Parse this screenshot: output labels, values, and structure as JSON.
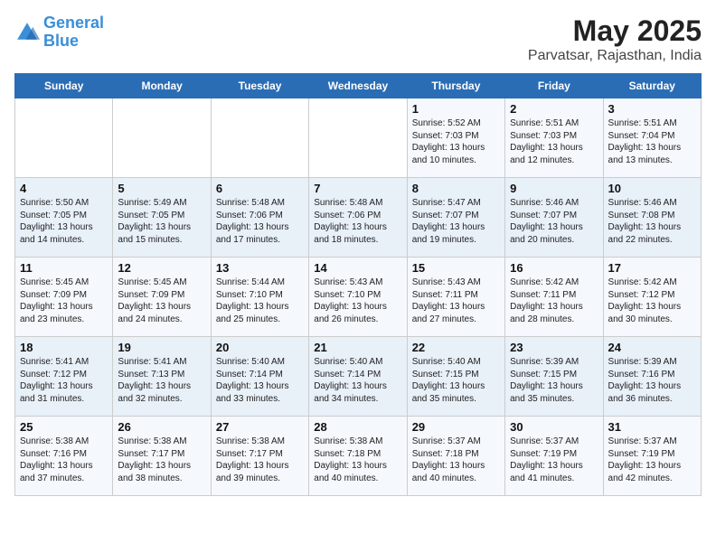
{
  "logo": {
    "line1": "General",
    "line2": "Blue"
  },
  "title": "May 2025",
  "subtitle": "Parvatsar, Rajasthan, India",
  "days_of_week": [
    "Sunday",
    "Monday",
    "Tuesday",
    "Wednesday",
    "Thursday",
    "Friday",
    "Saturday"
  ],
  "weeks": [
    [
      {
        "num": "",
        "lines": []
      },
      {
        "num": "",
        "lines": []
      },
      {
        "num": "",
        "lines": []
      },
      {
        "num": "",
        "lines": []
      },
      {
        "num": "1",
        "lines": [
          "Sunrise: 5:52 AM",
          "Sunset: 7:03 PM",
          "Daylight: 13 hours",
          "and 10 minutes."
        ]
      },
      {
        "num": "2",
        "lines": [
          "Sunrise: 5:51 AM",
          "Sunset: 7:03 PM",
          "Daylight: 13 hours",
          "and 12 minutes."
        ]
      },
      {
        "num": "3",
        "lines": [
          "Sunrise: 5:51 AM",
          "Sunset: 7:04 PM",
          "Daylight: 13 hours",
          "and 13 minutes."
        ]
      }
    ],
    [
      {
        "num": "4",
        "lines": [
          "Sunrise: 5:50 AM",
          "Sunset: 7:05 PM",
          "Daylight: 13 hours",
          "and 14 minutes."
        ]
      },
      {
        "num": "5",
        "lines": [
          "Sunrise: 5:49 AM",
          "Sunset: 7:05 PM",
          "Daylight: 13 hours",
          "and 15 minutes."
        ]
      },
      {
        "num": "6",
        "lines": [
          "Sunrise: 5:48 AM",
          "Sunset: 7:06 PM",
          "Daylight: 13 hours",
          "and 17 minutes."
        ]
      },
      {
        "num": "7",
        "lines": [
          "Sunrise: 5:48 AM",
          "Sunset: 7:06 PM",
          "Daylight: 13 hours",
          "and 18 minutes."
        ]
      },
      {
        "num": "8",
        "lines": [
          "Sunrise: 5:47 AM",
          "Sunset: 7:07 PM",
          "Daylight: 13 hours",
          "and 19 minutes."
        ]
      },
      {
        "num": "9",
        "lines": [
          "Sunrise: 5:46 AM",
          "Sunset: 7:07 PM",
          "Daylight: 13 hours",
          "and 20 minutes."
        ]
      },
      {
        "num": "10",
        "lines": [
          "Sunrise: 5:46 AM",
          "Sunset: 7:08 PM",
          "Daylight: 13 hours",
          "and 22 minutes."
        ]
      }
    ],
    [
      {
        "num": "11",
        "lines": [
          "Sunrise: 5:45 AM",
          "Sunset: 7:09 PM",
          "Daylight: 13 hours",
          "and 23 minutes."
        ]
      },
      {
        "num": "12",
        "lines": [
          "Sunrise: 5:45 AM",
          "Sunset: 7:09 PM",
          "Daylight: 13 hours",
          "and 24 minutes."
        ]
      },
      {
        "num": "13",
        "lines": [
          "Sunrise: 5:44 AM",
          "Sunset: 7:10 PM",
          "Daylight: 13 hours",
          "and 25 minutes."
        ]
      },
      {
        "num": "14",
        "lines": [
          "Sunrise: 5:43 AM",
          "Sunset: 7:10 PM",
          "Daylight: 13 hours",
          "and 26 minutes."
        ]
      },
      {
        "num": "15",
        "lines": [
          "Sunrise: 5:43 AM",
          "Sunset: 7:11 PM",
          "Daylight: 13 hours",
          "and 27 minutes."
        ]
      },
      {
        "num": "16",
        "lines": [
          "Sunrise: 5:42 AM",
          "Sunset: 7:11 PM",
          "Daylight: 13 hours",
          "and 28 minutes."
        ]
      },
      {
        "num": "17",
        "lines": [
          "Sunrise: 5:42 AM",
          "Sunset: 7:12 PM",
          "Daylight: 13 hours",
          "and 30 minutes."
        ]
      }
    ],
    [
      {
        "num": "18",
        "lines": [
          "Sunrise: 5:41 AM",
          "Sunset: 7:12 PM",
          "Daylight: 13 hours",
          "and 31 minutes."
        ]
      },
      {
        "num": "19",
        "lines": [
          "Sunrise: 5:41 AM",
          "Sunset: 7:13 PM",
          "Daylight: 13 hours",
          "and 32 minutes."
        ]
      },
      {
        "num": "20",
        "lines": [
          "Sunrise: 5:40 AM",
          "Sunset: 7:14 PM",
          "Daylight: 13 hours",
          "and 33 minutes."
        ]
      },
      {
        "num": "21",
        "lines": [
          "Sunrise: 5:40 AM",
          "Sunset: 7:14 PM",
          "Daylight: 13 hours",
          "and 34 minutes."
        ]
      },
      {
        "num": "22",
        "lines": [
          "Sunrise: 5:40 AM",
          "Sunset: 7:15 PM",
          "Daylight: 13 hours",
          "and 35 minutes."
        ]
      },
      {
        "num": "23",
        "lines": [
          "Sunrise: 5:39 AM",
          "Sunset: 7:15 PM",
          "Daylight: 13 hours",
          "and 35 minutes."
        ]
      },
      {
        "num": "24",
        "lines": [
          "Sunrise: 5:39 AM",
          "Sunset: 7:16 PM",
          "Daylight: 13 hours",
          "and 36 minutes."
        ]
      }
    ],
    [
      {
        "num": "25",
        "lines": [
          "Sunrise: 5:38 AM",
          "Sunset: 7:16 PM",
          "Daylight: 13 hours",
          "and 37 minutes."
        ]
      },
      {
        "num": "26",
        "lines": [
          "Sunrise: 5:38 AM",
          "Sunset: 7:17 PM",
          "Daylight: 13 hours",
          "and 38 minutes."
        ]
      },
      {
        "num": "27",
        "lines": [
          "Sunrise: 5:38 AM",
          "Sunset: 7:17 PM",
          "Daylight: 13 hours",
          "and 39 minutes."
        ]
      },
      {
        "num": "28",
        "lines": [
          "Sunrise: 5:38 AM",
          "Sunset: 7:18 PM",
          "Daylight: 13 hours",
          "and 40 minutes."
        ]
      },
      {
        "num": "29",
        "lines": [
          "Sunrise: 5:37 AM",
          "Sunset: 7:18 PM",
          "Daylight: 13 hours",
          "and 40 minutes."
        ]
      },
      {
        "num": "30",
        "lines": [
          "Sunrise: 5:37 AM",
          "Sunset: 7:19 PM",
          "Daylight: 13 hours",
          "and 41 minutes."
        ]
      },
      {
        "num": "31",
        "lines": [
          "Sunrise: 5:37 AM",
          "Sunset: 7:19 PM",
          "Daylight: 13 hours",
          "and 42 minutes."
        ]
      }
    ]
  ]
}
